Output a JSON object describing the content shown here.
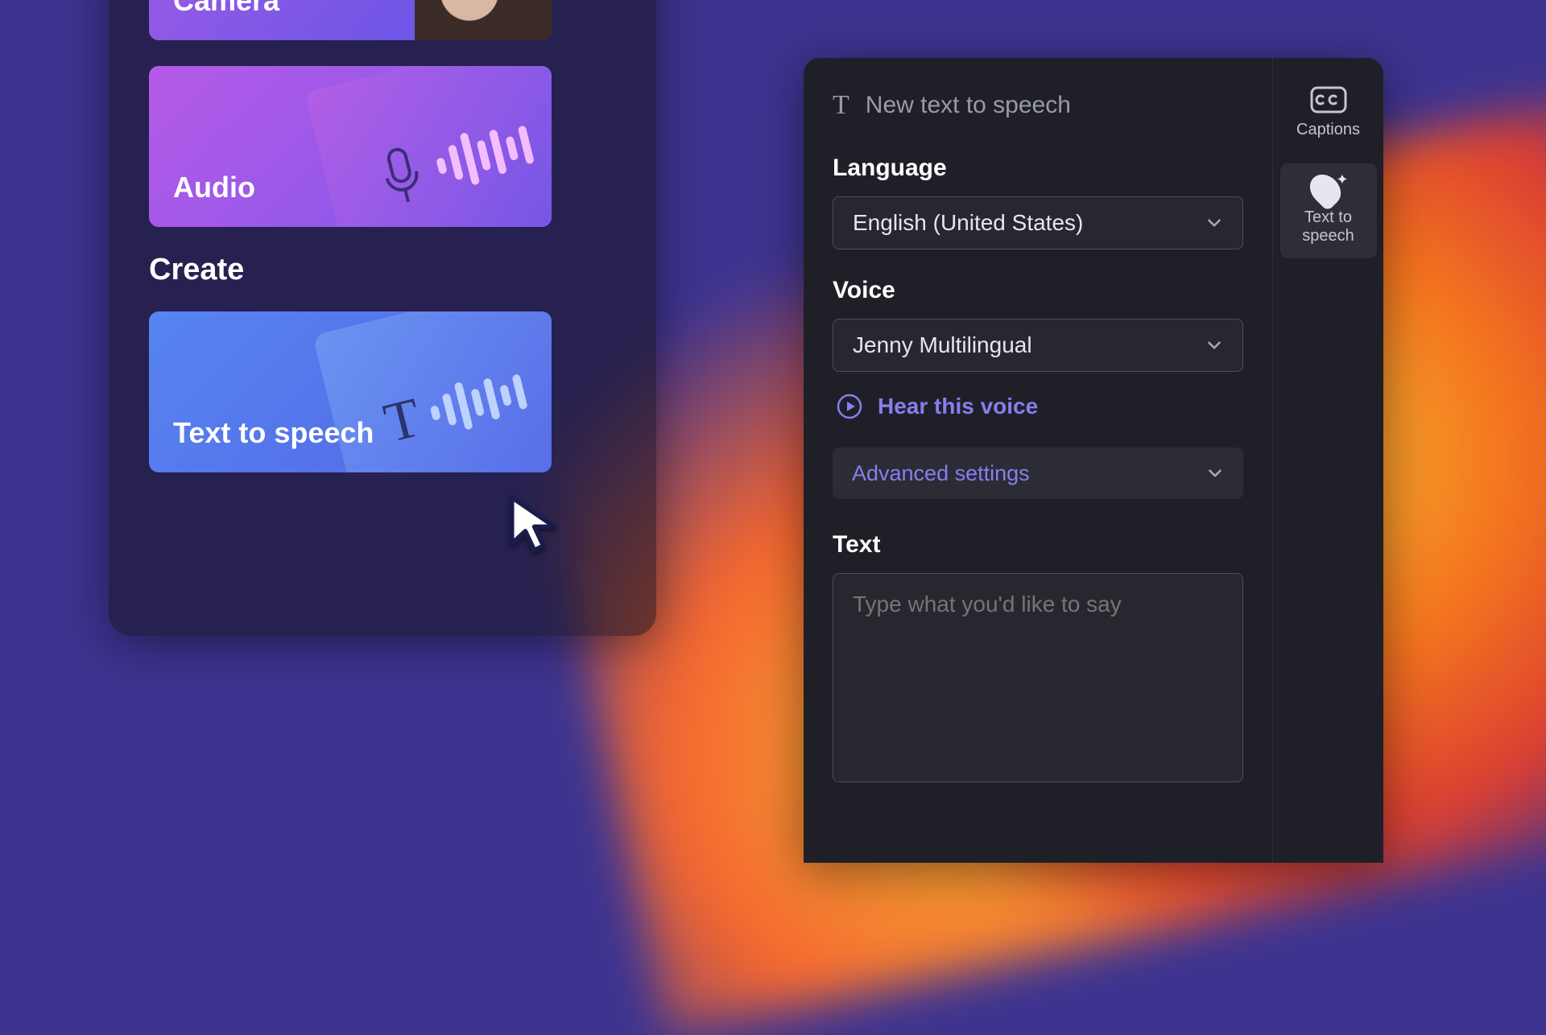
{
  "sidebar": {
    "tiles": {
      "camera_label": "Camera",
      "audio_label": "Audio",
      "tts_label": "Text to speech"
    },
    "create_heading": "Create"
  },
  "panel": {
    "title": "New text to speech",
    "language": {
      "label": "Language",
      "value": "English (United States)"
    },
    "voice": {
      "label": "Voice",
      "value": "Jenny Multilingual",
      "hear_label": "Hear this voice"
    },
    "advanced_label": "Advanced settings",
    "text": {
      "label": "Text",
      "placeholder": "Type what you'd like to say"
    }
  },
  "rail": {
    "captions_label": "Captions",
    "tts_label": "Text to speech"
  }
}
